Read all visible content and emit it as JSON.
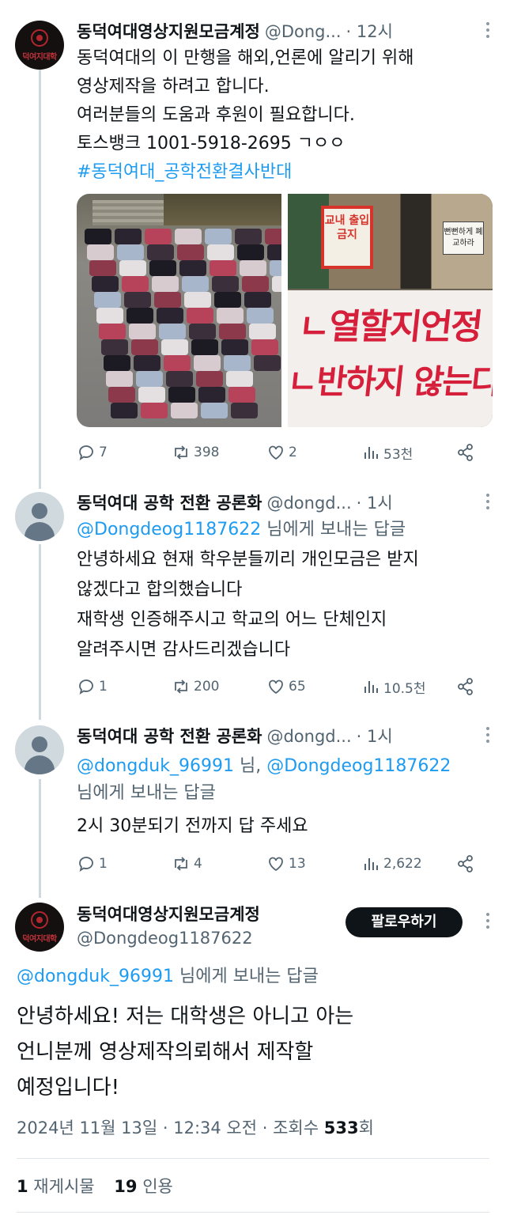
{
  "tweet1": {
    "name": "동덕여대영상지원모금계정",
    "handle": "@Dong...",
    "time": "· 12시",
    "avatar_text": "덕여지대학",
    "lines": [
      "동덕여대의 이 만행을 해외,언론에 알리기 위해",
      "영상제작을 하려고 합니다.",
      "여러분들의 도움과 후원이 필요합니다.",
      "토스뱅크 1001-5918-2695 ㄱㅇㅇ"
    ],
    "hashtag": "#동덕여대_공학전환결사반대",
    "media": {
      "sign_text": "교내 출입금지",
      "note_text": "뻔뻔하게 폐교하라",
      "banner_line1": "ㄴ열할지언정",
      "banner_line2": "ㄴ반하지 않는다"
    },
    "stats": {
      "replies": "7",
      "retweets": "398",
      "likes": "2",
      "views": "53천"
    }
  },
  "tweet2": {
    "name": "동덕여대 공학 전환 공론화",
    "handle": "@dongd...",
    "time": "· 1시",
    "reply_to_handle": "@Dongdeog1187622",
    "reply_to_suffix": " 님에게 보내는 답글",
    "lines": [
      "안녕하세요 현재 학우분들끼리 개인모금은 받지",
      "않겠다고 합의했습니다",
      "재학생 인증해주시고 학교의 어느 단체인지",
      "알려주시면 감사드리겠습니다"
    ],
    "stats": {
      "replies": "1",
      "retweets": "200",
      "likes": "65",
      "views": "10.5천"
    }
  },
  "tweet3": {
    "name": "동덕여대 공학 전환 공론화",
    "handle": "@dongd...",
    "time": "· 1시",
    "reply_to_handle_1": "@dongduk_96991",
    "reply_to_mid": " 님, ",
    "reply_to_handle_2": "@Dongdeog1187622",
    "reply_to_suffix": "님에게 보내는 답글",
    "lines": [
      "2시 30분되기 전까지 답 주세요"
    ],
    "stats": {
      "replies": "1",
      "retweets": "4",
      "likes": "13",
      "views": "2,622"
    }
  },
  "main_tweet": {
    "name": "동덕여대영상지원모금계정",
    "handle": "@Dongdeog1187622",
    "avatar_text": "덕여지대학",
    "follow_label": "팔로우하기",
    "reply_to_handle": "@dongduk_96991",
    "reply_to_suffix": " 님에게 보내는 답글",
    "lines": [
      "안녕하세요! 저는 대학생은 아니고 아는",
      "언니분께 영상제작의뢰해서 제작할",
      "예정입니다!"
    ],
    "meta_prefix": "2024년 11월 13일 · 12:34 오전 · 조회수 ",
    "meta_views": "533",
    "meta_suffix": "회",
    "retweet_count": "1",
    "retweet_label": " 재게시물",
    "quote_count": "19",
    "quote_label": " 인용"
  },
  "colors": {
    "link": "#1d9bf0",
    "muted": "#536471",
    "text": "#0f1419",
    "thread": "#cfd9de"
  },
  "icons": [
    "reply-icon",
    "retweet-icon",
    "like-icon",
    "views-icon",
    "share-icon",
    "more-icon"
  ]
}
